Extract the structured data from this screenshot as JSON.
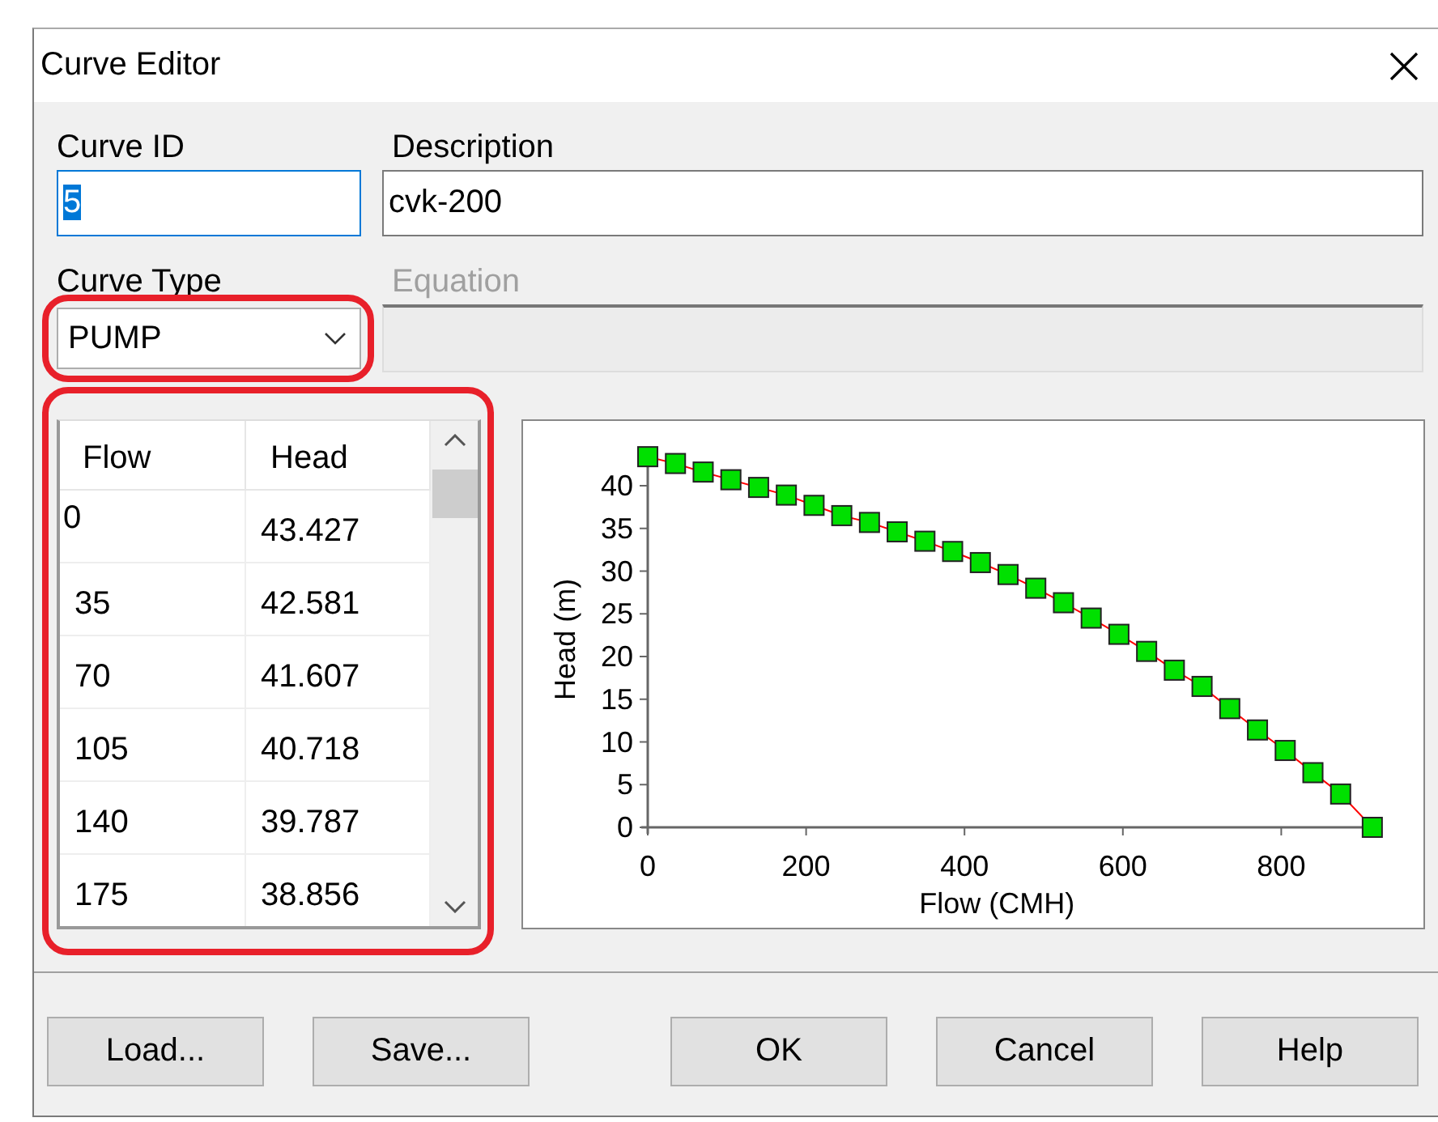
{
  "window": {
    "title": "Curve Editor"
  },
  "curve_id": {
    "label": "Curve ID",
    "value": "5",
    "focused": true,
    "text_selected": true
  },
  "description": {
    "label": "Description",
    "value": "cvk-200"
  },
  "curve_type": {
    "label": "Curve Type",
    "value": "PUMP",
    "highlighted": true
  },
  "equation": {
    "label": "Equation",
    "disabled": true
  },
  "table": {
    "highlighted": true,
    "columns": [
      "Flow",
      "Head"
    ],
    "rows": [
      {
        "cells": [
          "0",
          "43.427"
        ],
        "editing": true
      },
      {
        "cells": [
          "35",
          "42.581"
        ],
        "editing": false
      },
      {
        "cells": [
          "70",
          "41.607"
        ],
        "editing": false
      },
      {
        "cells": [
          "105",
          "40.718"
        ],
        "editing": false
      },
      {
        "cells": [
          "140",
          "39.787"
        ],
        "editing": false
      },
      {
        "cells": [
          "175",
          "38.856"
        ],
        "editing": false
      }
    ]
  },
  "chart": {
    "chart_data": {
      "type": "line",
      "xlabel": "Flow (CMH)",
      "ylabel": "Head (m)",
      "x": [
        0,
        35,
        70,
        105,
        140,
        175,
        210,
        245,
        280,
        315,
        350,
        385,
        420,
        455,
        490,
        525,
        560,
        595,
        630,
        665,
        700,
        735,
        770,
        805,
        840,
        875,
        915
      ],
      "series": [
        {
          "color": "#ff0000",
          "marker": "square",
          "values": [
            43.4,
            42.6,
            41.6,
            40.7,
            39.8,
            38.9,
            37.7,
            36.5,
            35.7,
            34.6,
            33.5,
            32.3,
            31.0,
            29.6,
            28.0,
            26.3,
            24.5,
            22.6,
            20.6,
            18.4,
            16.5,
            13.9,
            11.4,
            9.0,
            6.4,
            3.9,
            0
          ]
        }
      ],
      "xlim": [
        0,
        920
      ],
      "ylim": [
        0,
        44
      ],
      "xticks": [
        {
          "value": 0,
          "label": "0"
        },
        {
          "value": 200,
          "label": "200"
        },
        {
          "value": 400,
          "label": "400"
        },
        {
          "value": 600,
          "label": "600"
        },
        {
          "value": 800,
          "label": "800"
        }
      ],
      "yticks": [
        {
          "value": 0,
          "label": "0"
        },
        {
          "value": 5,
          "label": "5"
        },
        {
          "value": 10,
          "label": "10"
        },
        {
          "value": 15,
          "label": "15"
        },
        {
          "value": 20,
          "label": "20"
        },
        {
          "value": 25,
          "label": "25"
        },
        {
          "value": 30,
          "label": "30"
        },
        {
          "value": 35,
          "label": "35"
        },
        {
          "value": 40,
          "label": "40"
        }
      ]
    }
  },
  "buttons": [
    {
      "label": "Load...",
      "gap_before": false
    },
    {
      "label": "Save...",
      "gap_before": false
    },
    {
      "label": "OK",
      "gap_before": true
    },
    {
      "label": "Cancel",
      "gap_before": false
    },
    {
      "label": "Help",
      "gap_before": false
    }
  ]
}
